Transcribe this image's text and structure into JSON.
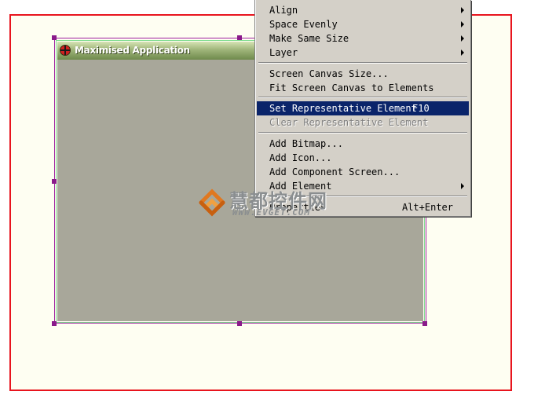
{
  "window": {
    "title": "Maximised Application"
  },
  "context_menu": {
    "items": [
      {
        "label": "Align",
        "shortcut": "",
        "submenu": true,
        "state": "normal"
      },
      {
        "label": "Space Evenly",
        "shortcut": "",
        "submenu": true,
        "state": "normal"
      },
      {
        "label": "Make Same Size",
        "shortcut": "",
        "submenu": true,
        "state": "normal"
      },
      {
        "label": "Layer",
        "shortcut": "",
        "submenu": true,
        "state": "normal"
      },
      {
        "label": "Screen Canvas Size...",
        "shortcut": "",
        "submenu": false,
        "state": "normal"
      },
      {
        "label": "Fit Screen Canvas to Elements",
        "shortcut": "",
        "submenu": false,
        "state": "normal"
      },
      {
        "label": "Set Representative Element",
        "shortcut": "F10",
        "submenu": false,
        "state": "highlighted"
      },
      {
        "label": "Clear Representative Element",
        "shortcut": "",
        "submenu": false,
        "state": "disabled"
      },
      {
        "label": "Add Bitmap...",
        "shortcut": "",
        "submenu": false,
        "state": "normal"
      },
      {
        "label": "Add Icon...",
        "shortcut": "",
        "submenu": false,
        "state": "normal"
      },
      {
        "label": "Add Component Screen...",
        "shortcut": "",
        "submenu": false,
        "state": "normal"
      },
      {
        "label": "Add Element",
        "shortcut": "",
        "submenu": true,
        "state": "normal"
      },
      {
        "label": "Properties",
        "shortcut": "Alt+Enter",
        "submenu": false,
        "state": "normal"
      }
    ]
  },
  "watermark": {
    "text_cn": "慧都控件网",
    "url": "WWW.EVGET.COM"
  },
  "colors": {
    "canvas_border": "#e8141e",
    "canvas_fill": "#fefef2",
    "selection_handle": "#8a1a8a",
    "window_body": "#a8a79a",
    "menu_background": "#d4d0c8",
    "menu_highlight": "#0a246a"
  }
}
